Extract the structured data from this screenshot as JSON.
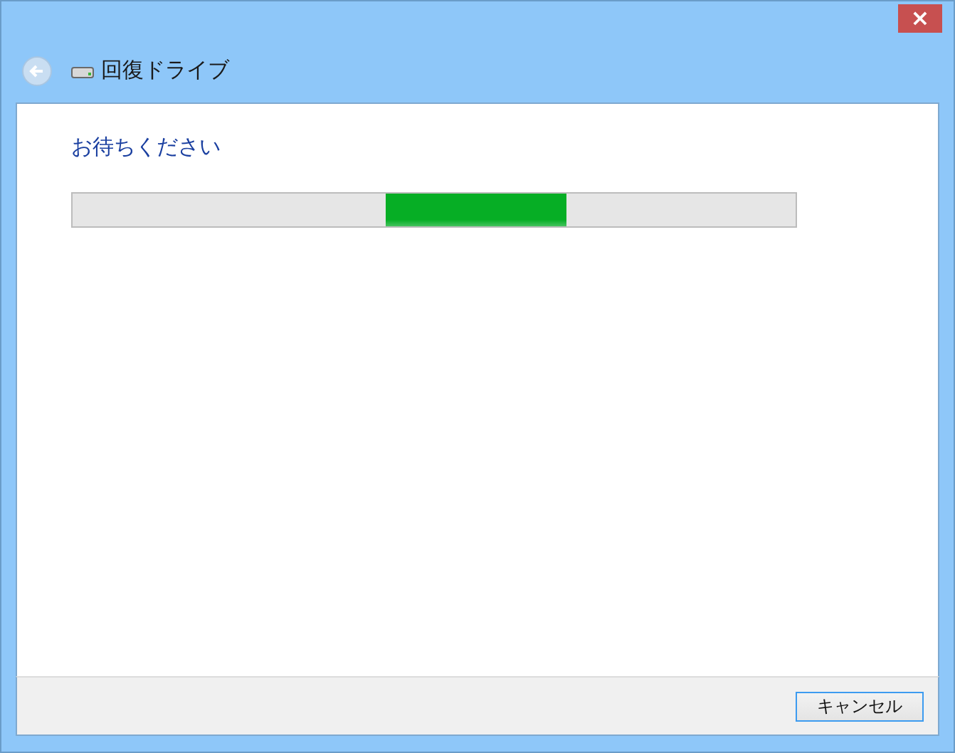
{
  "window": {
    "close_button": "×"
  },
  "header": {
    "title": "回復ドライブ",
    "back_disabled": true
  },
  "content": {
    "heading": "お待ちください",
    "progress": {
      "kind": "marquee"
    }
  },
  "buttons": [
    {
      "label": "キャンセル",
      "focused": true
    }
  ]
}
